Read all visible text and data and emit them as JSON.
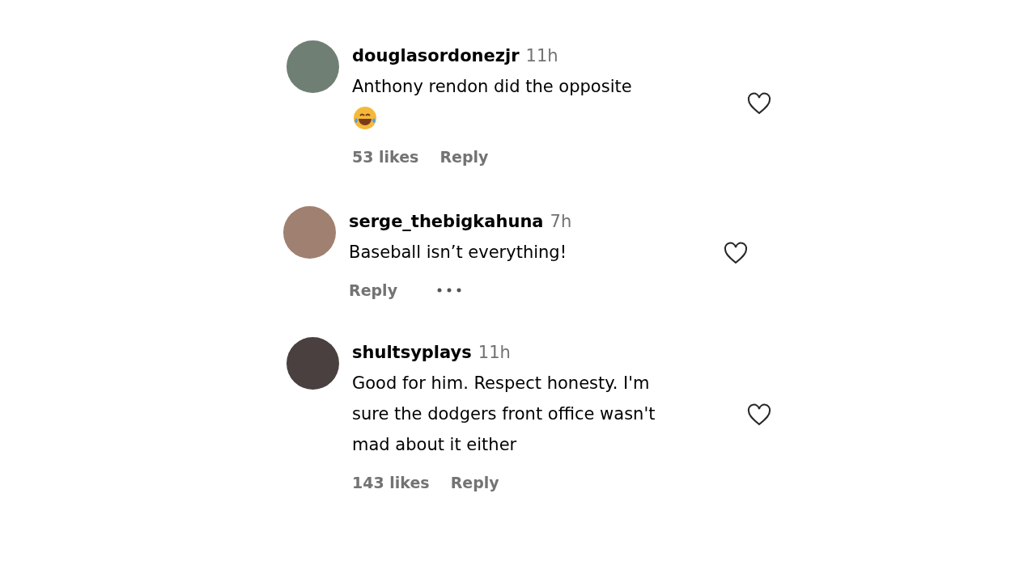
{
  "comments": [
    {
      "username": "douglasordonezjr",
      "time": "11h",
      "text": "Anthony rendon did the opposite",
      "emoji": true,
      "liked": false,
      "actions": [
        {
          "kind": "likes",
          "label": "53 likes"
        },
        {
          "kind": "reply",
          "label": "Reply"
        }
      ]
    },
    {
      "username": "serge_thebigkahuna",
      "time": "7h",
      "text": "Baseball isn’t everything!",
      "liked": false,
      "actions": [
        {
          "kind": "reply",
          "label": "Reply"
        },
        {
          "kind": "more"
        }
      ]
    },
    {
      "username": "shultsyplays",
      "time": "11h",
      "text": "Good for him. Respect honesty. I'm\nsure the dodgers front office wasn't\nmad about it either",
      "liked": false,
      "actions": [
        {
          "kind": "likes",
          "label": "143 likes"
        },
        {
          "kind": "reply",
          "label": "Reply"
        }
      ]
    }
  ]
}
